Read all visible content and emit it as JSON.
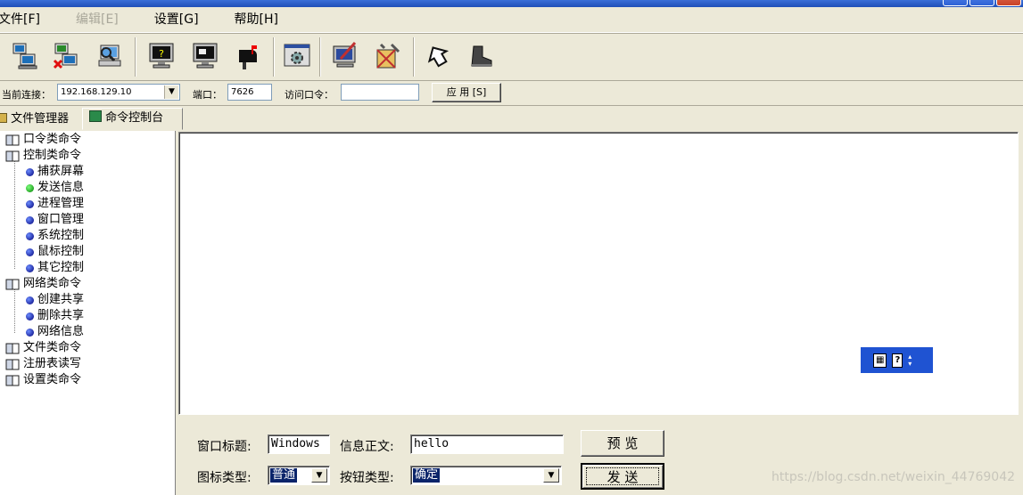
{
  "menu": [
    "文件[F]",
    "编辑[E]",
    "设置[G]",
    "帮助[H]"
  ],
  "connection": {
    "current_label": "当前连接：",
    "current_value": "192.168.129.10",
    "port_label": "端口：",
    "port_value": "7626",
    "password_label": "访问口令：",
    "password_value": "",
    "apply_label": "应 用 [S]"
  },
  "tabs": [
    "文件管理器",
    "命令控制台"
  ],
  "tree": {
    "groups": [
      "口令类命令",
      "控制类命令",
      "网络类命令",
      "文件类命令",
      "注册表读写",
      "设置类命令"
    ],
    "control_items": [
      "捕获屏幕",
      "发送信息",
      "进程管理",
      "窗口管理",
      "系统控制",
      "鼠标控制",
      "其它控制"
    ],
    "network_items": [
      "创建共享",
      "删除共享",
      "网络信息"
    ]
  },
  "form": {
    "window_title_label": "窗口标题:",
    "window_title_value": "Windows",
    "message_label": "信息正文:",
    "message_value": "hello",
    "icon_type_label": "图标类型:",
    "icon_type_value": "普通",
    "button_type_label": "按钮类型:",
    "button_type_value": "确定",
    "preview_label": "预 览",
    "send_label": "发 送"
  },
  "watermark": "https://blog.csdn.net/weixin_44769042"
}
